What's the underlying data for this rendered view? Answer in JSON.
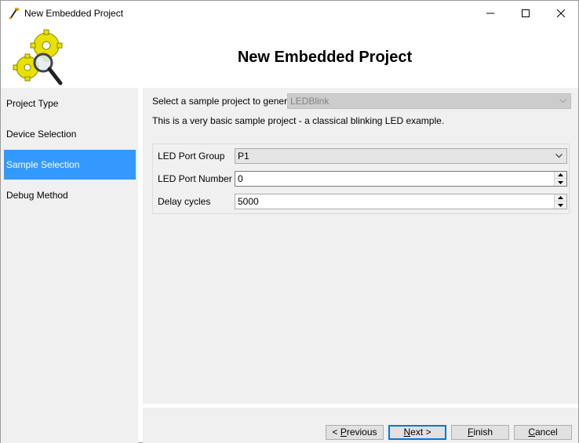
{
  "window": {
    "title": "New Embedded Project",
    "controls": {
      "minimize": "minimize-icon",
      "maximize": "maximize-icon",
      "close": "close-icon"
    }
  },
  "header": {
    "title": "New Embedded Project",
    "logo_icon": "gears-magnifier-icon"
  },
  "nav": {
    "items": [
      {
        "label": "Project Type",
        "selected": false
      },
      {
        "label": "Device Selection",
        "selected": false
      },
      {
        "label": "Sample Selection",
        "selected": true
      },
      {
        "label": "Debug Method",
        "selected": false
      }
    ]
  },
  "main": {
    "sample_label": "Select a sample project to generate:",
    "sample_value": "LEDBlink",
    "sample_description": "This is a very basic sample project - a classical blinking LED example.",
    "fields": {
      "port_group_label": "LED Port Group",
      "port_group_value": "P1",
      "port_number_label": "LED Port Number",
      "port_number_value": "0",
      "delay_label": "Delay cycles",
      "delay_value": "5000"
    }
  },
  "buttons": {
    "previous": {
      "prefix": "< ",
      "mnemonic": "P",
      "rest": "revious"
    },
    "next": {
      "mnemonic": "N",
      "rest": "ext >"
    },
    "finish": {
      "mnemonic": "F",
      "rest": "inish"
    },
    "cancel": {
      "mnemonic": "C",
      "rest": "ancel"
    }
  },
  "colors": {
    "selection": "#3399ff",
    "panel_bg": "#f0f0f0",
    "default_button_border": "#0078d7"
  }
}
